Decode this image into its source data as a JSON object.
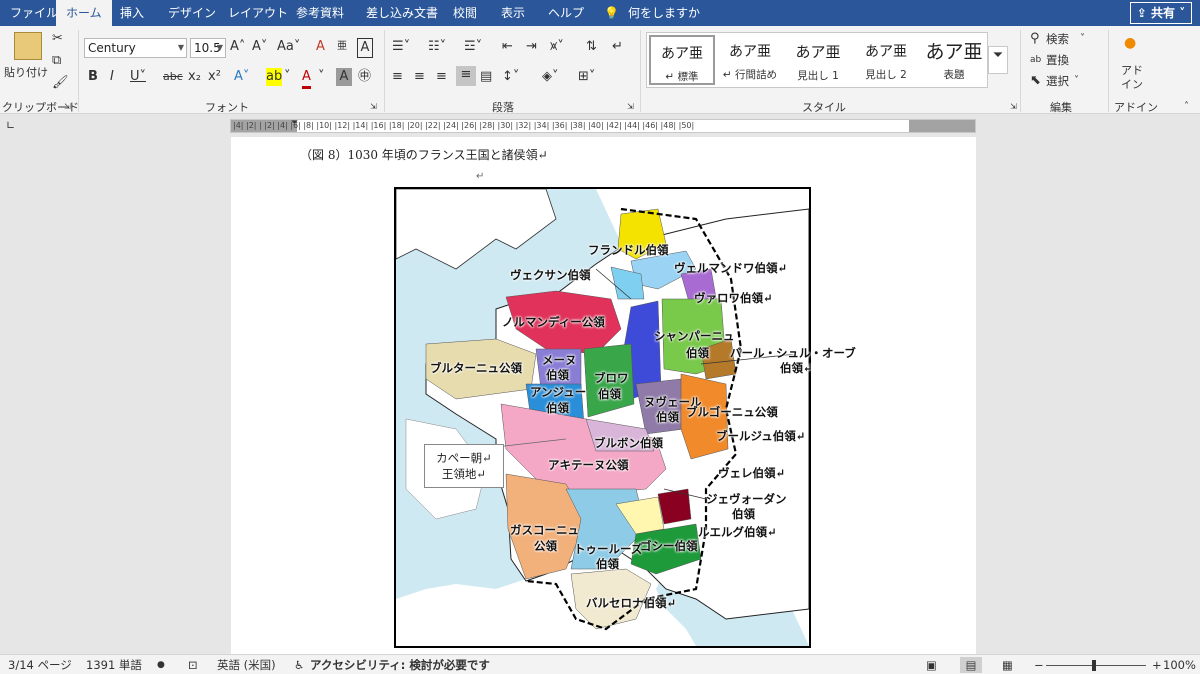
{
  "tabs": [
    "ファイル",
    "ホーム",
    "挿入",
    "デザイン",
    "レイアウト",
    "参考資料",
    "差し込み文書",
    "校閲",
    "表示",
    "ヘルプ"
  ],
  "tell_me": "何をしますか",
  "share": "共有",
  "clipboard": {
    "paste": "貼り付け",
    "label": "クリップボード"
  },
  "font": {
    "name": "Century",
    "size": "10.5",
    "label": "フォント"
  },
  "paragraph": {
    "label": "段落"
  },
  "styles": {
    "label": "スタイル",
    "items": [
      {
        "sample": "あア亜",
        "name": "↵ 標準"
      },
      {
        "sample": "あア亜",
        "name": "↵ 行間詰め"
      },
      {
        "sample": "あア亜",
        "name": "見出し 1"
      },
      {
        "sample": "あア亜",
        "name": "見出し 2"
      },
      {
        "sample": "あア亜",
        "name": "表題"
      }
    ]
  },
  "editing": {
    "label": "編集",
    "search": "検索",
    "replace": "置換",
    "select": "選択"
  },
  "addins": {
    "label": "アドイン",
    "button": "アド\nイン"
  },
  "ruler": "|4| |2| | |2| |4| |6| |8| |10| |12| |14| |16| |18| |20| |22| |24| |26| |28| |30| |32| |34| |36| |38| |40| |42| |44| |46| |48| |50|",
  "document": {
    "caption": "（図 8）1030 年頃のフランス王国と諸侯領↵",
    "return_mark": "↵",
    "legend": [
      "カペー朝↵",
      "王領地↵"
    ],
    "map_labels": [
      "フランドル伯領",
      "ヴェルマンドワ伯領↵",
      "ヴェクサン伯領",
      "ヴァロワ伯領↵",
      "ノルマンディー公領",
      "シャンパーニュ",
      "伯領",
      "ブルターニュ公領",
      "メーヌ",
      "伯領",
      "バール・シュル・オーブ",
      "伯領↵",
      "アンジュー",
      "伯領",
      "ブロワ",
      "伯領",
      "ヌヴェール",
      "伯領",
      "ブルゴーニュ公領",
      "ブルボン伯領",
      "ブールジュ伯領↵",
      "アキテーヌ公領",
      "ヴェレ伯領↵",
      "ジェヴォーダン",
      "伯領",
      "ルエルグ伯領↵",
      "ガスコーニュ",
      "公領",
      "トゥールーズ",
      "伯領",
      "ゴシー伯領",
      "バルセロナ伯領↵"
    ]
  },
  "status": {
    "page": "3/14 ページ",
    "words": "1391 単語",
    "language": "英語 (米国)",
    "accessibility": "アクセシビリティ: 検討が必要です",
    "zoom": "100%",
    "zoom_level": 1.0,
    "minus": "−",
    "plus": "+"
  }
}
